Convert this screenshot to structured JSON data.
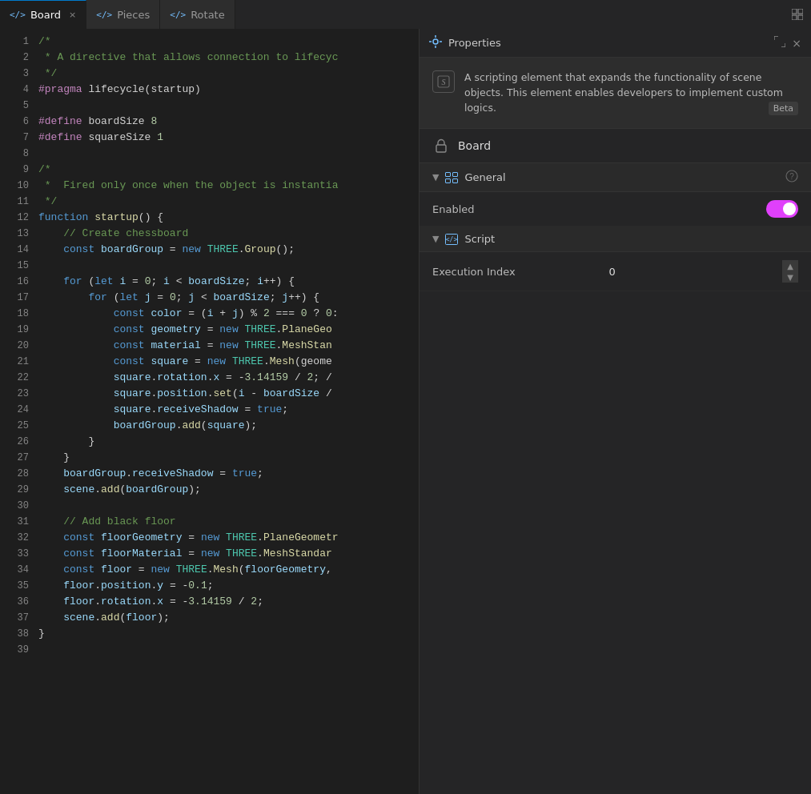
{
  "tabs": [
    {
      "id": "board",
      "label": "Board",
      "icon": "</>",
      "active": true,
      "closable": true
    },
    {
      "id": "pieces",
      "label": "Pieces",
      "icon": "</>",
      "active": false,
      "closable": false
    },
    {
      "id": "rotate",
      "label": "Rotate",
      "icon": "</>",
      "active": false,
      "closable": false
    }
  ],
  "editor": {
    "lines": [
      {
        "n": 1,
        "code": "/*"
      },
      {
        "n": 2,
        "code": " * A directive that allows connection to lifecyc"
      },
      {
        "n": 3,
        "code": " */"
      },
      {
        "n": 4,
        "code": "#pragma lifecycle(startup)"
      },
      {
        "n": 5,
        "code": ""
      },
      {
        "n": 6,
        "code": "#define boardSize 8"
      },
      {
        "n": 7,
        "code": "#define squareSize 1"
      },
      {
        "n": 8,
        "code": ""
      },
      {
        "n": 9,
        "code": "/*"
      },
      {
        "n": 10,
        "code": " *  Fired only once when the object is instantia"
      },
      {
        "n": 11,
        "code": " */"
      },
      {
        "n": 12,
        "code": "function startup() {"
      },
      {
        "n": 13,
        "code": "    // Create chessboard"
      },
      {
        "n": 14,
        "code": "    const boardGroup = new THREE.Group();"
      },
      {
        "n": 15,
        "code": ""
      },
      {
        "n": 16,
        "code": "    for (let i = 0; i < boardSize; i++) {"
      },
      {
        "n": 17,
        "code": "        for (let j = 0; j < boardSize; j++) {"
      },
      {
        "n": 18,
        "code": "            const color = (i + j) % 2 === 0 ? 0:"
      },
      {
        "n": 19,
        "code": "            const geometry = new THREE.PlaneGeo"
      },
      {
        "n": 20,
        "code": "            const material = new THREE.MeshStan"
      },
      {
        "n": 21,
        "code": "            const square = new THREE.Mesh(geome"
      },
      {
        "n": 22,
        "code": "            square.rotation.x = -3.14159 / 2; /"
      },
      {
        "n": 23,
        "code": "            square.position.set(i - boardSize /"
      },
      {
        "n": 24,
        "code": "            square.receiveShadow = true;"
      },
      {
        "n": 25,
        "code": "            boardGroup.add(square);"
      },
      {
        "n": 26,
        "code": "        }"
      },
      {
        "n": 27,
        "code": "    }"
      },
      {
        "n": 28,
        "code": "    boardGroup.receiveShadow = true;"
      },
      {
        "n": 29,
        "code": "    scene.add(boardGroup);"
      },
      {
        "n": 30,
        "code": ""
      },
      {
        "n": 31,
        "code": "    // Add black floor"
      },
      {
        "n": 32,
        "code": "    const floorGeometry = new THREE.PlaneGeometr"
      },
      {
        "n": 33,
        "code": "    const floorMaterial = new THREE.MeshStandar"
      },
      {
        "n": 34,
        "code": "    const floor = new THREE.Mesh(floorGeometry,"
      },
      {
        "n": 35,
        "code": "    floor.position.y = -0.1;"
      },
      {
        "n": 36,
        "code": "    floor.rotation.x = -3.14159 / 2;"
      },
      {
        "n": 37,
        "code": "    scene.add(floor);"
      },
      {
        "n": 38,
        "code": "}"
      },
      {
        "n": 39,
        "code": ""
      }
    ]
  },
  "properties": {
    "title": "Properties",
    "header_icon": "⚙",
    "close_label": "×",
    "expand_label": "⤢",
    "info_text": "A scripting element that expands the functionality of scene objects. This element enables developers to implement custom logics.",
    "beta_label": "Beta",
    "board_name": "Board",
    "general_section": {
      "title": "General",
      "help_icon": "?",
      "enabled_label": "Enabled",
      "enabled": true
    },
    "script_section": {
      "title": "Script",
      "execution_index_label": "Execution Index",
      "execution_index_value": "0"
    }
  }
}
